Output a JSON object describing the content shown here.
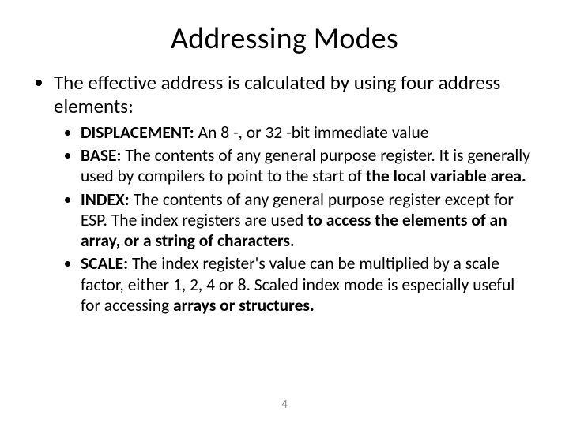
{
  "title": "Addressing Modes",
  "intro": "The effective address is calculated by using four address elements:",
  "items": [
    {
      "label": "DISPLACEMENT:",
      "text": " An 8 -, or 32 -bit immediate value",
      "boldTail": ""
    },
    {
      "label": "BASE:",
      "text": " The contents of any general purpose register. It is generally used by compilers to point to the start of ",
      "boldTail": "the local variable area."
    },
    {
      "label": "INDEX:",
      "text": " The contents of any general purpose register except for ESP. The index registers are used ",
      "boldTail": "to access the elements of an array, or a string of characters."
    },
    {
      "label": "SCALE:",
      "text": " The index register's value can be multiplied by a scale factor, either 1, 2, 4 or 8. Scaled index mode is especially useful for accessing ",
      "boldTail": "arrays or structures."
    }
  ],
  "pageNumber": "4"
}
